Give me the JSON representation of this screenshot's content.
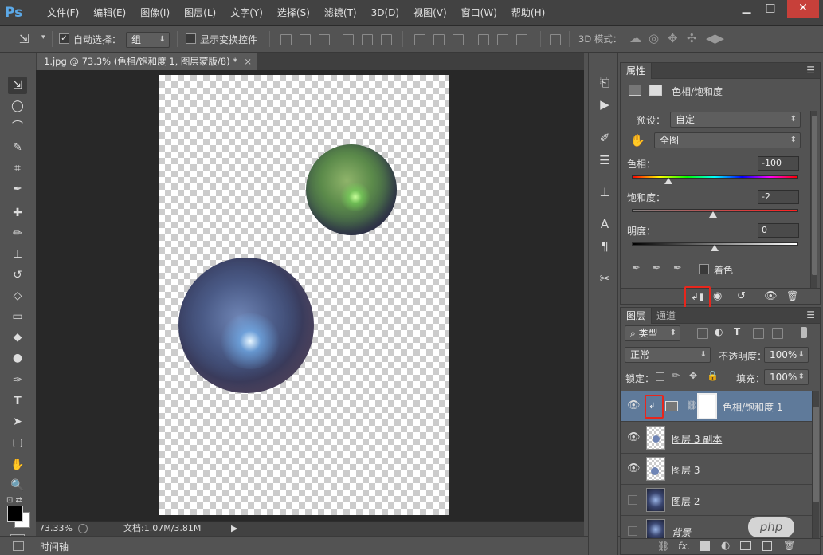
{
  "app": {
    "logo": "Ps"
  },
  "menu": [
    "文件(F)",
    "编辑(E)",
    "图像(I)",
    "图层(L)",
    "文字(Y)",
    "选择(S)",
    "滤镜(T)",
    "3D(D)",
    "视图(V)",
    "窗口(W)",
    "帮助(H)"
  ],
  "window_controls": {
    "minimize": "▁",
    "restore": "□",
    "close": "✕"
  },
  "options": {
    "auto_select_label": "自动选择：",
    "auto_select_value": "组",
    "show_transform_label": "显示变换控件",
    "mode_3d_label": "3D 模式："
  },
  "document": {
    "tab_title": "1.jpg @ 73.3% (色相/饱和度 1, 图层蒙版/8) *",
    "tab_close": "×",
    "zoom": "73.33%",
    "doc_info": "文档:1.07M/3.81M"
  },
  "timeline_label": "时间轴",
  "properties": {
    "tab": "属性",
    "adjustment_title": "色相/饱和度",
    "preset_label": "预设：",
    "preset_value": "自定",
    "channel_value": "全图",
    "hue_label": "色相：",
    "hue_value": -100,
    "saturation_label": "饱和度：",
    "saturation_value": -2,
    "lightness_label": "明度：",
    "lightness_value": 0,
    "colorize_label": "着色"
  },
  "layers": {
    "tab_layers": "图层",
    "tab_channels": "通道",
    "filter_kind": "类型",
    "blend_mode": "正常",
    "opacity_label": "不透明度：",
    "opacity_value": "100%",
    "lock_label": "锁定：",
    "fill_label": "填充：",
    "fill_value": "100%",
    "items": [
      {
        "name": "色相/饱和度 1",
        "visible": true,
        "selected": true
      },
      {
        "name": "图层 3 副本",
        "visible": true,
        "selected": false
      },
      {
        "name": "图层 3",
        "visible": true,
        "selected": false
      },
      {
        "name": "图层 2",
        "visible": false,
        "selected": false
      },
      {
        "name": "背景",
        "visible": false,
        "selected": false
      }
    ]
  },
  "watermark": "php",
  "colors": {
    "accent_selected": "#5f7a9a",
    "highlight": "#e8261c"
  }
}
